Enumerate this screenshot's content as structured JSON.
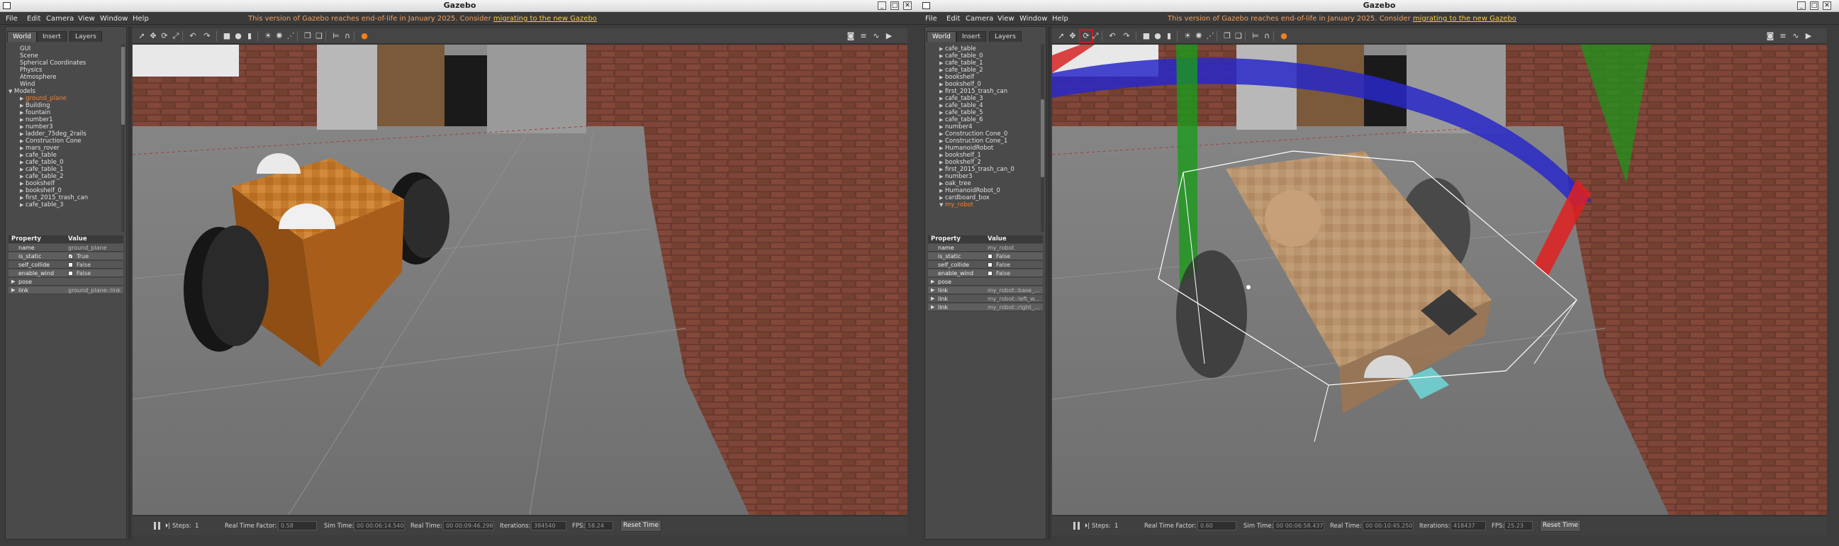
{
  "windows": [
    {
      "id": "left",
      "title": "Gazebo",
      "menu": [
        "File",
        "Edit",
        "Camera",
        "View",
        "Window",
        "Help"
      ],
      "eol_notice": "This version of Gazebo reaches end-of-life in January 2025. Consider ",
      "eol_link": "migrating to the new Gazebo",
      "tabs": [
        "World",
        "Insert",
        "Layers"
      ],
      "tree": [
        {
          "label": "GUI",
          "indent": 1,
          "arrow": ""
        },
        {
          "label": "Scene",
          "indent": 1,
          "arrow": ""
        },
        {
          "label": "Spherical Coordinates",
          "indent": 1,
          "arrow": ""
        },
        {
          "label": "Physics",
          "indent": 1,
          "arrow": ""
        },
        {
          "label": "Atmosphere",
          "indent": 1,
          "arrow": ""
        },
        {
          "label": "Wind",
          "indent": 1,
          "arrow": ""
        },
        {
          "label": "Models",
          "indent": 0,
          "arrow": "▼"
        },
        {
          "label": "ground_plane",
          "indent": 2,
          "arrow": "▶",
          "selected": true
        },
        {
          "label": "Building",
          "indent": 2,
          "arrow": "▶"
        },
        {
          "label": "fountain",
          "indent": 2,
          "arrow": "▶"
        },
        {
          "label": "number1",
          "indent": 2,
          "arrow": "▶"
        },
        {
          "label": "number3",
          "indent": 2,
          "arrow": "▶"
        },
        {
          "label": "ladder_75deg_2rails",
          "indent": 2,
          "arrow": "▶"
        },
        {
          "label": "Construction Cone",
          "indent": 2,
          "arrow": "▶"
        },
        {
          "label": "mars_rover",
          "indent": 2,
          "arrow": "▶"
        },
        {
          "label": "cafe_table",
          "indent": 2,
          "arrow": "▶"
        },
        {
          "label": "cafe_table_0",
          "indent": 2,
          "arrow": "▶"
        },
        {
          "label": "cafe_table_1",
          "indent": 2,
          "arrow": "▶"
        },
        {
          "label": "cafe_table_2",
          "indent": 2,
          "arrow": "▶"
        },
        {
          "label": "bookshelf",
          "indent": 2,
          "arrow": "▶"
        },
        {
          "label": "bookshelf_0",
          "indent": 2,
          "arrow": "▶"
        },
        {
          "label": "first_2015_trash_can",
          "indent": 2,
          "arrow": "▶"
        },
        {
          "label": "cafe_table_3",
          "indent": 2,
          "arrow": "▶"
        }
      ],
      "properties_header": {
        "property": "Property",
        "value": "Value"
      },
      "properties": [
        {
          "key": "name",
          "value": "ground_plane",
          "type": "text"
        },
        {
          "key": "is_static",
          "value": "True",
          "type": "check",
          "checked": true
        },
        {
          "key": "self_collide",
          "value": "False",
          "type": "check",
          "checked": false
        },
        {
          "key": "enable_wind",
          "value": "False",
          "type": "check",
          "checked": false
        },
        {
          "key": "pose",
          "value": "",
          "type": "group"
        },
        {
          "key": "link",
          "value": "ground_plane::link",
          "type": "group"
        }
      ],
      "bottom": {
        "steps_label": "Steps:",
        "steps_value": "1",
        "rtf_label": "Real Time Factor:",
        "rtf_value": "0.58",
        "sim_label": "Sim Time:",
        "sim_value": "00 00:06:14.540",
        "real_label": "Real Time:",
        "real_value": "00 00:09:46.298",
        "iter_label": "Iterations:",
        "iter_value": "384540",
        "fps_label": "FPS:",
        "fps_value": "58.24",
        "reset": "Reset Time"
      }
    },
    {
      "id": "right",
      "title": "Gazebo",
      "menu": [
        "File",
        "Edit",
        "Camera",
        "View",
        "Window",
        "Help"
      ],
      "eol_notice": "This version of Gazebo reaches end-of-life in January 2025. Consider ",
      "eol_link": "migrating to the new Gazebo",
      "tabs": [
        "World",
        "Insert",
        "Layers"
      ],
      "tree": [
        {
          "label": "cafe_table",
          "indent": 2,
          "arrow": "▶"
        },
        {
          "label": "cafe_table_0",
          "indent": 2,
          "arrow": "▶"
        },
        {
          "label": "cafe_table_1",
          "indent": 2,
          "arrow": "▶"
        },
        {
          "label": "cafe_table_2",
          "indent": 2,
          "arrow": "▶"
        },
        {
          "label": "bookshelf",
          "indent": 2,
          "arrow": "▶"
        },
        {
          "label": "bookshelf_0",
          "indent": 2,
          "arrow": "▶"
        },
        {
          "label": "first_2015_trash_can",
          "indent": 2,
          "arrow": "▶"
        },
        {
          "label": "cafe_table_3",
          "indent": 2,
          "arrow": "▶"
        },
        {
          "label": "cafe_table_4",
          "indent": 2,
          "arrow": "▶"
        },
        {
          "label": "cafe_table_5",
          "indent": 2,
          "arrow": "▶"
        },
        {
          "label": "cafe_table_6",
          "indent": 2,
          "arrow": "▶"
        },
        {
          "label": "number4",
          "indent": 2,
          "arrow": "▶"
        },
        {
          "label": "Construction Cone_0",
          "indent": 2,
          "arrow": "▶"
        },
        {
          "label": "Construction Cone_1",
          "indent": 2,
          "arrow": "▶"
        },
        {
          "label": "HumanoidRobot",
          "indent": 2,
          "arrow": "▶"
        },
        {
          "label": "bookshelf_1",
          "indent": 2,
          "arrow": "▶"
        },
        {
          "label": "bookshelf_2",
          "indent": 2,
          "arrow": "▶"
        },
        {
          "label": "first_2015_trash_can_0",
          "indent": 2,
          "arrow": "▶"
        },
        {
          "label": "number3",
          "indent": 2,
          "arrow": "▶"
        },
        {
          "label": "oak_tree",
          "indent": 2,
          "arrow": "▶"
        },
        {
          "label": "HumanoidRobot_0",
          "indent": 2,
          "arrow": "▶"
        },
        {
          "label": "cardboard_box",
          "indent": 2,
          "arrow": "▶"
        },
        {
          "label": "my_robot",
          "indent": 2,
          "arrow": "▼",
          "selected": true
        }
      ],
      "properties_header": {
        "property": "Property",
        "value": "Value"
      },
      "properties": [
        {
          "key": "name",
          "value": "my_robot",
          "type": "text"
        },
        {
          "key": "is_static",
          "value": "False",
          "type": "check",
          "checked": false
        },
        {
          "key": "self_collide",
          "value": "False",
          "type": "check",
          "checked": false
        },
        {
          "key": "enable_wind",
          "value": "False",
          "type": "check",
          "checked": false
        },
        {
          "key": "pose",
          "value": "",
          "type": "group"
        },
        {
          "key": "link",
          "value": "my_robot::base_...",
          "type": "group"
        },
        {
          "key": "link",
          "value": "my_robot::left_w...",
          "type": "group"
        },
        {
          "key": "link",
          "value": "my_robot::right_...",
          "type": "group"
        }
      ],
      "bottom": {
        "steps_label": "Steps:",
        "steps_value": "1",
        "rtf_label": "Real Time Factor:",
        "rtf_value": "0.60",
        "sim_label": "Sim Time:",
        "sim_value": "00 00:06:58.437",
        "real_label": "Real Time:",
        "real_value": "00 00:10:45.250",
        "iter_label": "Iterations:",
        "iter_value": "418437",
        "fps_label": "FPS:",
        "fps_value": "25.23",
        "reset": "Reset Time"
      }
    }
  ],
  "toolbar_icons": [
    "select-arrow-icon",
    "translate-icon",
    "rotate-icon",
    "scale-icon",
    "undo-icon",
    "redo-icon",
    "box-icon",
    "sphere-icon",
    "cylinder-icon",
    "sun-light-icon",
    "point-light-icon",
    "spot-light-icon",
    "copy-icon",
    "paste-icon",
    "align-icon",
    "snap-icon",
    "orange-record-icon",
    "screenshot-icon",
    "log-icon",
    "plot-icon",
    "video-icon"
  ],
  "colors": {
    "eol_text": "#f2a060",
    "eol_link": "#f5d040",
    "selected_item": "#f08030",
    "active_tool_border": "#c02020"
  }
}
